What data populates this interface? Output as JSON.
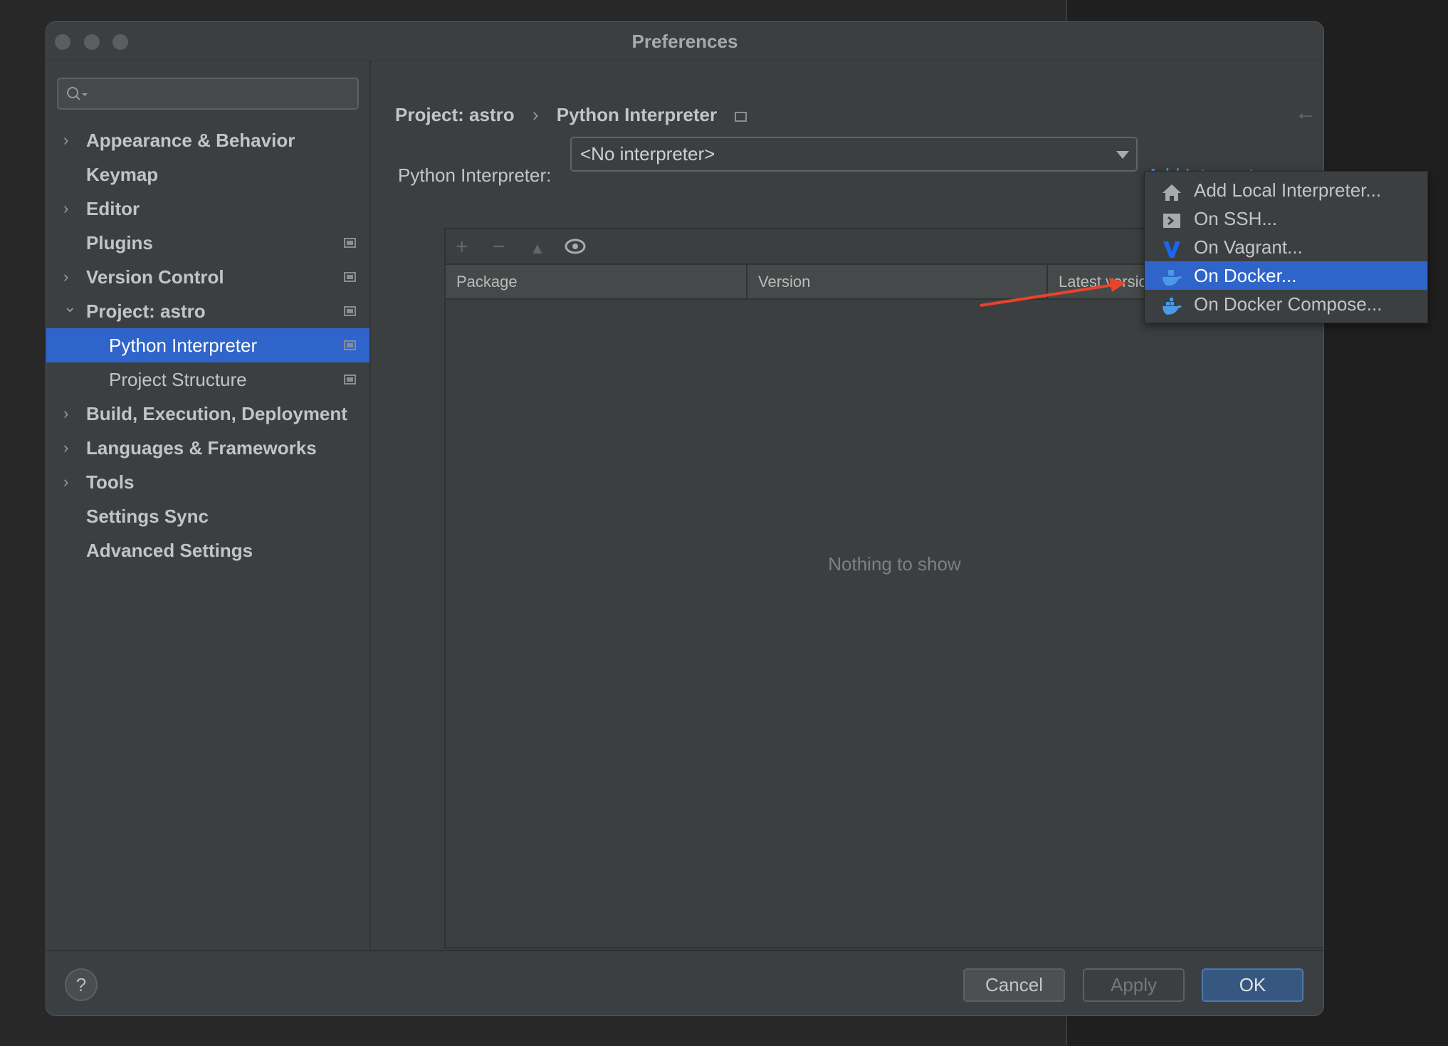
{
  "window": {
    "title": "Preferences"
  },
  "sidebar": {
    "search": {
      "placeholder": "",
      "value": ""
    },
    "items": [
      {
        "label": "Appearance & Behavior",
        "expandable": true,
        "expanded": false,
        "child": false,
        "project_icon": false
      },
      {
        "label": "Keymap",
        "expandable": false,
        "child": false,
        "project_icon": false
      },
      {
        "label": "Editor",
        "expandable": true,
        "expanded": false,
        "child": false,
        "project_icon": false
      },
      {
        "label": "Plugins",
        "expandable": false,
        "child": false,
        "project_icon": true
      },
      {
        "label": "Version Control",
        "expandable": true,
        "expanded": false,
        "child": false,
        "project_icon": true
      },
      {
        "label": "Project: astro",
        "expandable": true,
        "expanded": true,
        "child": false,
        "project_icon": true
      },
      {
        "label": "Python Interpreter",
        "child": true,
        "selected": true,
        "project_icon": true
      },
      {
        "label": "Project Structure",
        "child": true,
        "project_icon": true
      },
      {
        "label": "Build, Execution, Deployment",
        "expandable": true,
        "expanded": false,
        "child": false,
        "project_icon": false
      },
      {
        "label": "Languages & Frameworks",
        "expandable": true,
        "expanded": false,
        "child": false,
        "project_icon": false
      },
      {
        "label": "Tools",
        "expandable": true,
        "expanded": false,
        "child": false,
        "project_icon": false
      },
      {
        "label": "Settings Sync",
        "expandable": false,
        "child": false,
        "project_icon": false
      },
      {
        "label": "Advanced Settings",
        "expandable": false,
        "child": false,
        "project_icon": false
      }
    ]
  },
  "breadcrumb": {
    "parent": "Project: astro",
    "separator": "›",
    "current": "Python Interpreter"
  },
  "interpreter": {
    "label": "Python Interpreter:",
    "value": "<No interpreter>",
    "add_label": "Add Interpreter"
  },
  "packages": {
    "columns": [
      "Package",
      "Version",
      "Latest version"
    ],
    "empty_text": "Nothing to show"
  },
  "add_menu": {
    "items": [
      {
        "label": "Add Local Interpreter...",
        "icon": "home-icon"
      },
      {
        "label": "On SSH...",
        "icon": "terminal-icon"
      },
      {
        "label": "On Vagrant...",
        "icon": "vagrant-icon"
      },
      {
        "label": "On Docker...",
        "icon": "docker-icon",
        "highlighted": true
      },
      {
        "label": "On Docker Compose...",
        "icon": "docker-compose-icon"
      }
    ]
  },
  "footer": {
    "help": "?",
    "cancel": "Cancel",
    "apply": "Apply",
    "ok": "OK"
  },
  "colors": {
    "accent": "#2f65ca",
    "link": "#4b8fe3",
    "annotation_arrow": "#e8432b"
  }
}
